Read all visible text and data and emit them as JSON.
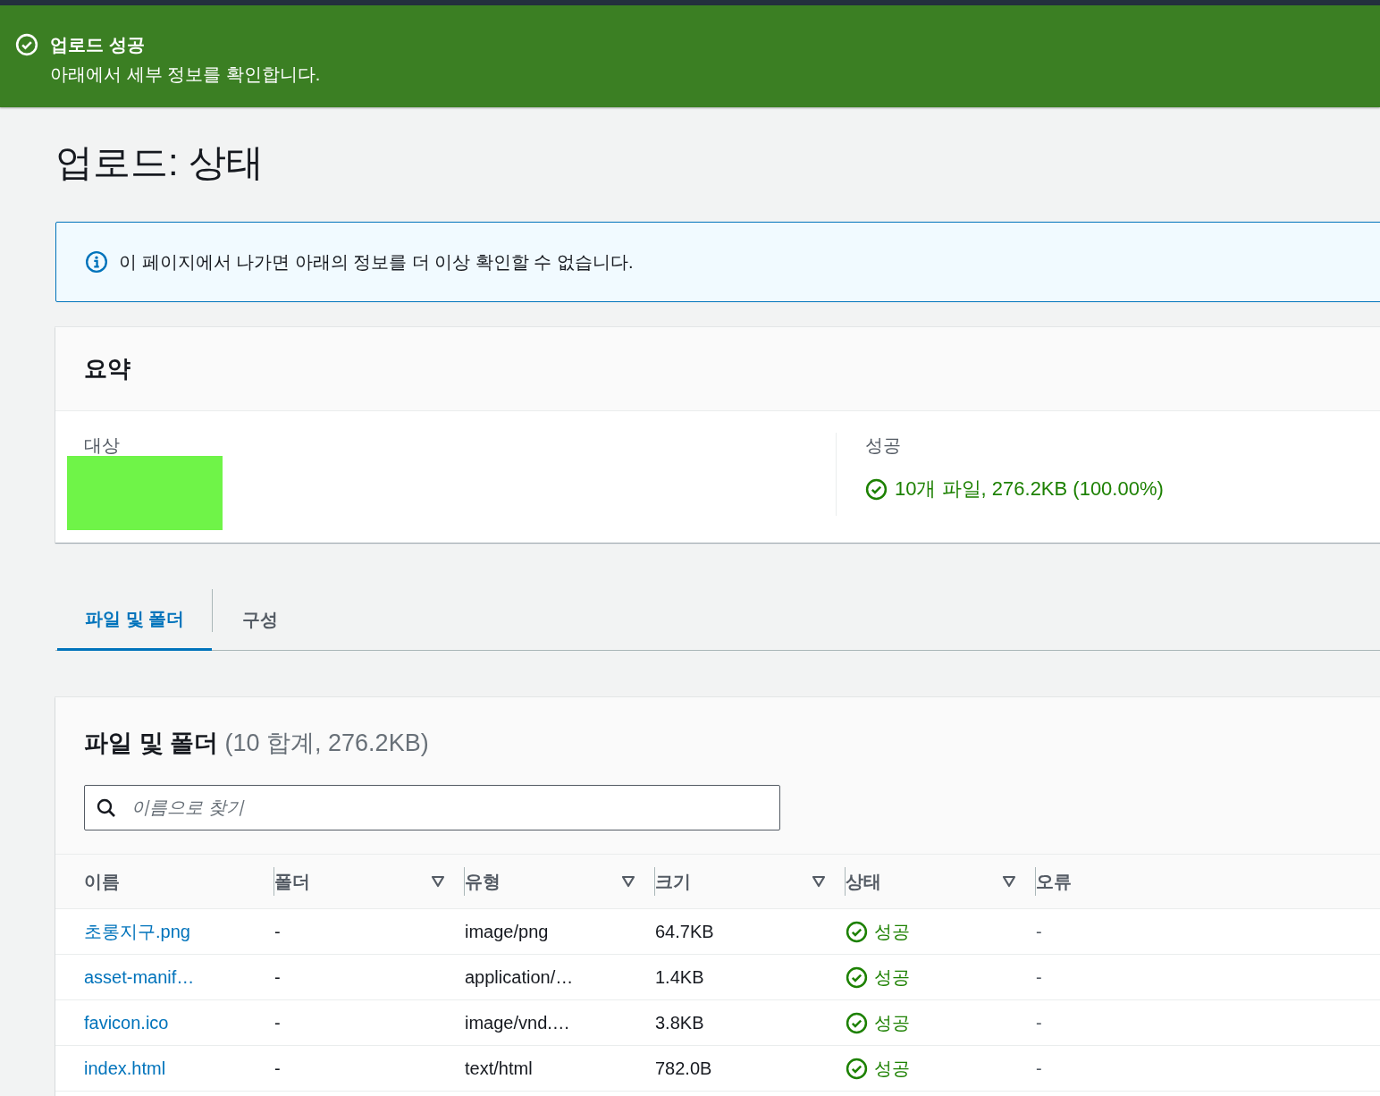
{
  "flash": {
    "kind": "success",
    "title": "업로드 성공",
    "message": "아래에서 세부 정보를 확인합니다."
  },
  "page_title": "업로드: 상태",
  "info_alert": {
    "text": "이 페이지에서 나가면 아래의 정보를 더 이상 확인할 수 없습니다."
  },
  "summary": {
    "title": "요약",
    "destination_label": "대상",
    "success_label": "성공",
    "success_value": "10개 파일, 276.2KB (100.00%)"
  },
  "tabs": [
    {
      "label": "파일 및 폴더",
      "selected": true
    },
    {
      "label": "구성",
      "selected": false
    }
  ],
  "files": {
    "title": "파일 및 폴더",
    "count": "(10 합계, 276.2KB)",
    "search": {
      "placeholder": "이름으로 찾기"
    },
    "columns": [
      {
        "label": "이름",
        "filterable": false
      },
      {
        "label": "폴더",
        "filterable": true
      },
      {
        "label": "유형",
        "filterable": true
      },
      {
        "label": "크기",
        "filterable": true
      },
      {
        "label": "상태",
        "filterable": true
      },
      {
        "label": "오류",
        "filterable": false
      }
    ],
    "rows": [
      {
        "name": "초롱지구.png",
        "folder": "-",
        "type": "image/png",
        "size": "64.7KB",
        "status": "성공",
        "error": "-"
      },
      {
        "name": "asset-manif…",
        "folder": "-",
        "type": "application/…",
        "size": "1.4KB",
        "status": "성공",
        "error": "-"
      },
      {
        "name": "favicon.ico",
        "folder": "-",
        "type": "image/vnd.…",
        "size": "3.8KB",
        "status": "성공",
        "error": "-"
      },
      {
        "name": "index.html",
        "folder": "-",
        "type": "text/html",
        "size": "782.0B",
        "status": "성공",
        "error": "-"
      }
    ]
  }
}
